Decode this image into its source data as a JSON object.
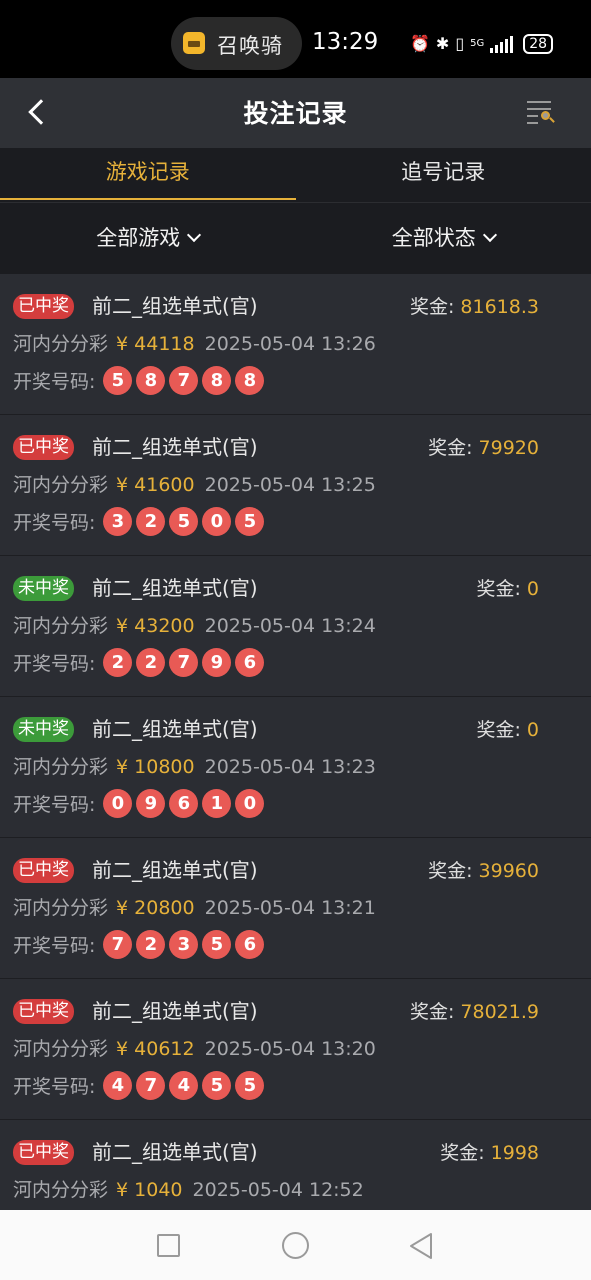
{
  "status_bar": {
    "app_pill_text": "召唤骑",
    "time": "13:29",
    "network": "5G",
    "battery": "28"
  },
  "header": {
    "title": "投注记录"
  },
  "tabs": [
    {
      "label": "游戏记录",
      "active": true
    },
    {
      "label": "追号记录",
      "active": false
    }
  ],
  "filters": {
    "game": "全部游戏",
    "status": "全部状态"
  },
  "labels": {
    "prize_prefix": "奖金: ",
    "numbers_prefix": "开奖号码:",
    "currency": "¥"
  },
  "records": [
    {
      "status": "已中奖",
      "won": true,
      "game": "前二_组选单式(官)",
      "prize": "81618.3",
      "lottery": "河内分分彩",
      "amount": "44118",
      "time": "2025-05-04 13:26",
      "numbers": [
        "5",
        "8",
        "7",
        "8",
        "8"
      ]
    },
    {
      "status": "已中奖",
      "won": true,
      "game": "前二_组选单式(官)",
      "prize": "79920",
      "lottery": "河内分分彩",
      "amount": "41600",
      "time": "2025-05-04 13:25",
      "numbers": [
        "3",
        "2",
        "5",
        "0",
        "5"
      ]
    },
    {
      "status": "未中奖",
      "won": false,
      "game": "前二_组选单式(官)",
      "prize": "0",
      "lottery": "河内分分彩",
      "amount": "43200",
      "time": "2025-05-04 13:24",
      "numbers": [
        "2",
        "2",
        "7",
        "9",
        "6"
      ]
    },
    {
      "status": "未中奖",
      "won": false,
      "game": "前二_组选单式(官)",
      "prize": "0",
      "lottery": "河内分分彩",
      "amount": "10800",
      "time": "2025-05-04 13:23",
      "numbers": [
        "0",
        "9",
        "6",
        "1",
        "0"
      ]
    },
    {
      "status": "已中奖",
      "won": true,
      "game": "前二_组选单式(官)",
      "prize": "39960",
      "lottery": "河内分分彩",
      "amount": "20800",
      "time": "2025-05-04 13:21",
      "numbers": [
        "7",
        "2",
        "3",
        "5",
        "6"
      ]
    },
    {
      "status": "已中奖",
      "won": true,
      "game": "前二_组选单式(官)",
      "prize": "78021.9",
      "lottery": "河内分分彩",
      "amount": "40612",
      "time": "2025-05-04 13:20",
      "numbers": [
        "4",
        "7",
        "4",
        "5",
        "5"
      ]
    },
    {
      "status": "已中奖",
      "won": true,
      "game": "前二_组选单式(官)",
      "prize": "1998",
      "lottery": "河内分分彩",
      "amount": "1040",
      "time": "2025-05-04 12:52",
      "numbers": []
    }
  ],
  "colors": {
    "accent": "#e6b13a",
    "win_badge": "#d43d3d",
    "lose_badge": "#3c9b3a",
    "ball": "#e85a55"
  },
  "icons": {
    "back": "chevron-left-icon",
    "filter": "list-search-icon",
    "nav_recent": "square-icon",
    "nav_home": "circle-icon",
    "nav_back": "triangle-back-icon"
  }
}
